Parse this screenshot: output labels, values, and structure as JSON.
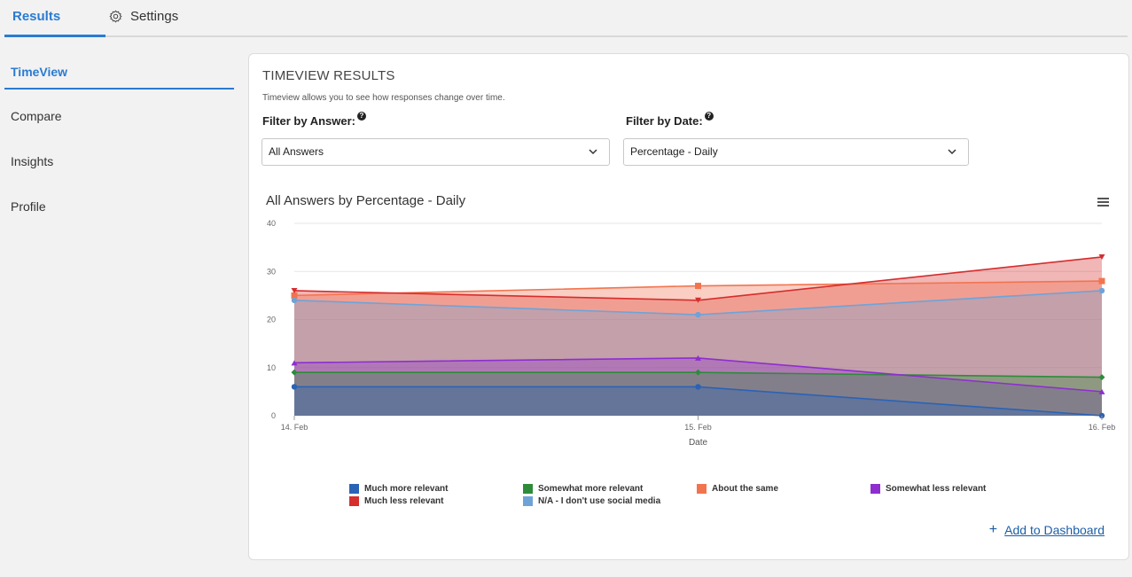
{
  "topbar": {
    "results_label": "Results",
    "settings_label": "Settings"
  },
  "sidebar": {
    "items": [
      {
        "label": "TimeView"
      },
      {
        "label": "Compare"
      },
      {
        "label": "Insights"
      },
      {
        "label": "Profile"
      }
    ]
  },
  "card": {
    "title": "TIMEVIEW RESULTS",
    "subtitle": "Timeview allows you to see how responses change over time.",
    "filter_answer_label": "Filter by Answer:",
    "filter_answer_value": "All Answers",
    "filter_date_label": "Filter by Date:",
    "filter_date_value": "Percentage - Daily",
    "add_dashboard_label": "Add to Dashboard"
  },
  "chart_data": {
    "type": "area",
    "title": "All Answers by Percentage - Daily",
    "xlabel": "Date",
    "ylabel": "",
    "categories": [
      "14. Feb",
      "15. Feb",
      "16. Feb"
    ],
    "ylim": [
      0,
      40
    ],
    "yticks": [
      0,
      10,
      20,
      30,
      40
    ],
    "grid": true,
    "legend_position": "bottom",
    "series": [
      {
        "name": "Much more relevant",
        "values": [
          6,
          6,
          0
        ],
        "color": "#2a63b5"
      },
      {
        "name": "Somewhat more relevant",
        "values": [
          9,
          9,
          8
        ],
        "color": "#2e8b3a"
      },
      {
        "name": "About the same",
        "values": [
          25,
          27,
          28
        ],
        "color": "#f2744f"
      },
      {
        "name": "Somewhat less relevant",
        "values": [
          11,
          12,
          5
        ],
        "color": "#8e2ecf"
      },
      {
        "name": "Much less relevant",
        "values": [
          26,
          24,
          33
        ],
        "color": "#d62d2d"
      },
      {
        "name": "N/A - I don't use social media",
        "values": [
          24,
          21,
          26
        ],
        "color": "#6ea3d8"
      }
    ]
  }
}
